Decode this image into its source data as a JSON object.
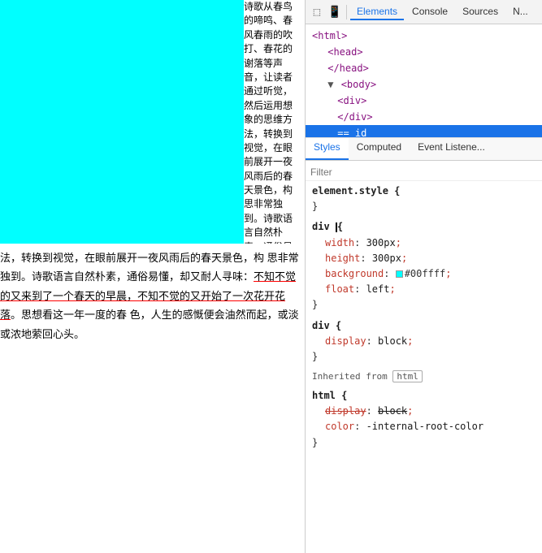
{
  "left": {
    "mainText1": "诗歌从春鸟的啼鸣、春风春雨的吹打、春花的谢落等声音，让读者通过听觉，然后运用想象的思维方",
    "columnText": "诗歌从春鸟的啼鸣、春风春雨的吹打、春花的谢落等声音，让读者通过听，然后运用想象的思维方法，转换到视觉，在眼前展开一夜风雨后的春天景色，构思非常独到。诗歌语言自然朴素，通俗易懂，却又耐人寻味：不知不觉的又来到了",
    "bottomText": "法，转换到视觉，在眼前展开一夜风雨后的春天景色，构 思非常独到。诗歌语言自然朴素，通俗易懂，却又耐人寻味：不知不觉的又来到了一个春天的早晨，不知不觉的又开始了一次花开花落。思想看这一年一度的春 色，人生的感慨便会油然而起，或淡或浓地萦回心头。",
    "underlineStart": "不知不觉的又来到了一个春天的早晨，不知不觉的又开始了一次花开花落"
  },
  "devtools": {
    "topTabs": {
      "elementsLabel": "Elements",
      "consoleLabel": "Console",
      "sourcesLabel": "Sources",
      "networkLabel": "N..."
    },
    "innerTabs": {
      "stylesLabel": "Styles",
      "computedLabel": "Computed",
      "eventListenerLabel": "Event Listene..."
    },
    "filterPlaceholder": "Filter",
    "dom": {
      "lines": [
        {
          "indent": 0,
          "html": "<html>",
          "selected": false
        },
        {
          "indent": 1,
          "html": "<head>",
          "selected": false
        },
        {
          "indent": 1,
          "html": "</head>",
          "selected": false
        },
        {
          "indent": 1,
          "html": "<body>",
          "selected": false,
          "hasTriangle": true
        },
        {
          "indent": 2,
          "html": "<div>",
          "selected": false
        },
        {
          "indent": 2,
          "html": "</div>",
          "selected": false
        },
        {
          "indent": 2,
          "html": "== id",
          "selected": true,
          "special": true
        }
      ]
    },
    "styles": {
      "elementStyle": {
        "selector": "element.style",
        "props": []
      },
      "divRule": {
        "selector": "div",
        "props": [
          {
            "name": "width",
            "value": "300px"
          },
          {
            "name": "height",
            "value": "300px"
          },
          {
            "name": "background",
            "value": "#00ffff",
            "hasColor": true
          },
          {
            "name": "float",
            "value": "left"
          }
        ]
      },
      "divRule2": {
        "selector": "div",
        "props": [
          {
            "name": "display",
            "value": "block"
          }
        ]
      },
      "inheritedHeader": "Inherited from",
      "inheritedTag": "html",
      "htmlRule": {
        "selector": "html",
        "props": [
          {
            "name": "display",
            "value": "block",
            "struck": true
          },
          {
            "name": "color",
            "value": "-internal-root-color",
            "struck": false
          }
        ]
      }
    }
  }
}
